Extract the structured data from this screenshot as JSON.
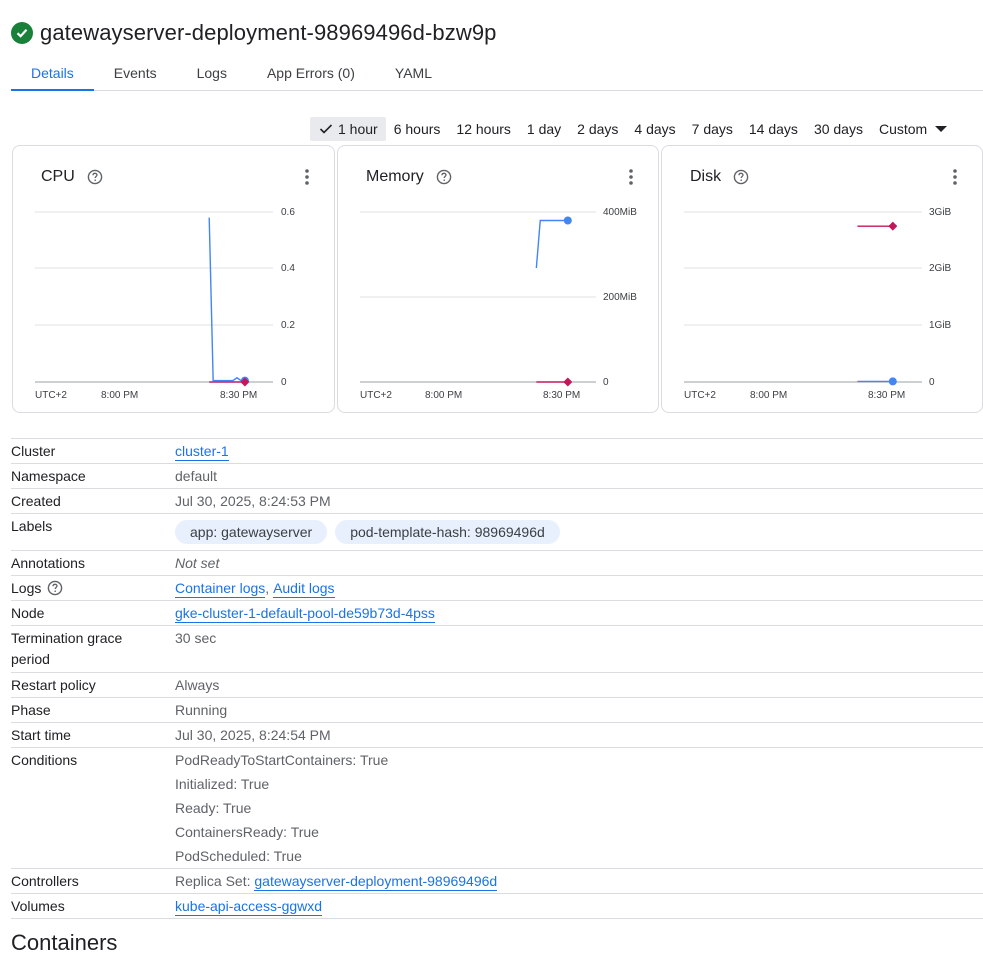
{
  "header": {
    "title": "gatewayserver-deployment-98969496d-bzw9p",
    "status_color": "#188038"
  },
  "tabs": [
    {
      "label": "Details",
      "active": true
    },
    {
      "label": "Events"
    },
    {
      "label": "Logs"
    },
    {
      "label": "App Errors (0)"
    },
    {
      "label": "YAML"
    }
  ],
  "time_range": {
    "options": [
      "1 hour",
      "6 hours",
      "12 hours",
      "1 day",
      "2 days",
      "4 days",
      "7 days",
      "14 days",
      "30 days"
    ],
    "selected": "1 hour",
    "custom_label": "Custom"
  },
  "charts": {
    "cpu": {
      "title": "CPU",
      "y_ticks": [
        "0.6",
        "0.4",
        "0.2",
        "0"
      ],
      "x_ticks": [
        "UTC+2",
        "8:00 PM",
        "8:30 PM"
      ]
    },
    "memory": {
      "title": "Memory",
      "y_ticks": [
        "400MiB",
        "200MiB",
        "0"
      ],
      "x_ticks": [
        "UTC+2",
        "8:00 PM",
        "8:30 PM"
      ]
    },
    "disk": {
      "title": "Disk",
      "y_ticks": [
        "3GiB",
        "2GiB",
        "1GiB",
        "0"
      ],
      "x_ticks": [
        "UTC+2",
        "8:00 PM",
        "8:30 PM"
      ]
    }
  },
  "chart_data": [
    {
      "type": "line",
      "title": "CPU",
      "ylim": [
        0,
        0.6
      ],
      "y_ticks": [
        0.6,
        0.4,
        0.2,
        0
      ],
      "x_ticks": [
        "UTC+2",
        "8:00 PM",
        "8:30 PM"
      ],
      "series": [
        {
          "color": "#4285f4",
          "x": [
            "8:24 PM",
            "8:25 PM",
            "8:27 PM",
            "8:30 PM",
            "8:31 PM",
            "8:32 PM",
            "8:33 PM"
          ],
          "values": [
            0.58,
            0.005,
            0.005,
            0.005,
            0.015,
            0.005,
            0.005
          ]
        },
        {
          "color": "#c2185b",
          "x": [
            "8:24 PM",
            "8:33 PM"
          ],
          "values": [
            0,
            0
          ]
        }
      ]
    },
    {
      "type": "line",
      "title": "Memory",
      "ylim": [
        0,
        400
      ],
      "y_ticks": [
        "400MiB",
        "200MiB",
        "0"
      ],
      "x_ticks": [
        "UTC+2",
        "8:00 PM",
        "8:30 PM"
      ],
      "series": [
        {
          "color": "#4285f4",
          "x": [
            "8:25 PM",
            "8:26 PM",
            "8:27 PM",
            "8:33 PM"
          ],
          "values": [
            268,
            380,
            380,
            380
          ]
        },
        {
          "color": "#c2185b",
          "x": [
            "8:25 PM",
            "8:33 PM"
          ],
          "values": [
            0,
            0
          ]
        }
      ]
    },
    {
      "type": "line",
      "title": "Disk",
      "ylim": [
        0,
        3
      ],
      "y_ticks": [
        "3GiB",
        "2GiB",
        "1GiB",
        "0"
      ],
      "x_ticks": [
        "UTC+2",
        "8:00 PM",
        "8:30 PM"
      ],
      "series": [
        {
          "color": "#c2185b",
          "x": [
            "8:24 PM",
            "8:33 PM"
          ],
          "values": [
            2.75,
            2.75
          ]
        },
        {
          "color": "#4285f4",
          "x": [
            "8:24 PM",
            "8:33 PM"
          ],
          "values": [
            0.01,
            0.01
          ]
        }
      ]
    }
  ],
  "details": {
    "cluster": {
      "label": "Cluster",
      "value": "cluster-1"
    },
    "namespace": {
      "label": "Namespace",
      "value": "default"
    },
    "created": {
      "label": "Created",
      "value": "Jul 30, 2025, 8:24:53 PM"
    },
    "labels": {
      "label": "Labels",
      "chips": [
        "app: gatewayserver",
        "pod-template-hash: 98969496d"
      ]
    },
    "annotations": {
      "label": "Annotations",
      "value": "Not set"
    },
    "logs": {
      "label": "Logs",
      "link1": "Container logs",
      "separator": ",",
      "link2": "Audit logs"
    },
    "node": {
      "label": "Node",
      "value": "gke-cluster-1-default-pool-de59b73d-4pss"
    },
    "termination": {
      "label_line1": "Termination grace",
      "label_line2": "period",
      "value": "30 sec"
    },
    "restart_policy": {
      "label": "Restart policy",
      "value": "Always"
    },
    "phase": {
      "label": "Phase",
      "value": "Running"
    },
    "start_time": {
      "label": "Start time",
      "value": "Jul 30, 2025, 8:24:54 PM"
    },
    "conditions": {
      "label": "Conditions",
      "items": [
        "PodReadyToStartContainers: True",
        "Initialized: True",
        "Ready: True",
        "ContainersReady: True",
        "PodScheduled: True"
      ]
    },
    "controllers": {
      "label": "Controllers",
      "prefix": "Replica Set:",
      "link": "gatewayserver-deployment-98969496d"
    },
    "volumes": {
      "label": "Volumes",
      "value": "kube-api-access-ggwxd"
    }
  },
  "containers_heading": "Containers"
}
